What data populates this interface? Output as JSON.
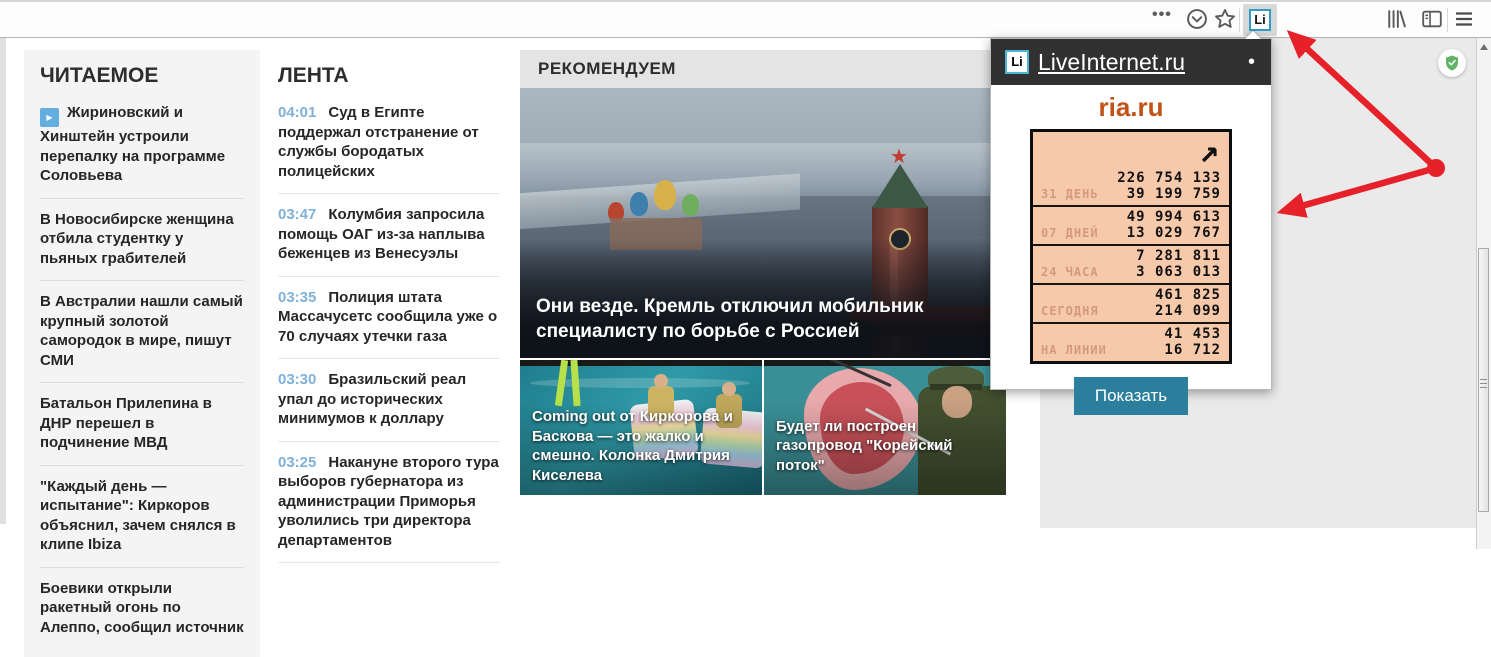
{
  "browser": {
    "li_badge": "Li"
  },
  "readable": {
    "title": "ЧИТАЕМОЕ",
    "items": [
      {
        "text": "Жириновский и Хинштейн устроили перепалку на программе Соловьева",
        "video": true
      },
      {
        "text": "В Новосибирске женщина отбила студентку у пьяных грабителей"
      },
      {
        "text": "В Австралии нашли самый крупный золотой самородок в мире, пишут СМИ"
      },
      {
        "text": "Батальон Прилепина в ДНР перешел в подчинение МВД"
      },
      {
        "text": "\"Каждый день — испытание\": Киркоров объяснил, зачем снялся в клипе Ibiza"
      },
      {
        "text": "Боевики открыли ракетный огонь по Алеппо, сообщил источник"
      }
    ]
  },
  "feed": {
    "title": "ЛЕНТА",
    "items": [
      {
        "time": "04:01",
        "text": "Суд в Египте поддержал отстранение от службы бородатых полицейских"
      },
      {
        "time": "03:47",
        "text": "Колумбия запросила помощь ОАГ из-за наплыва беженцев из Венесуэлы"
      },
      {
        "time": "03:35",
        "text": "Полиция штата Массачусетс сообщила уже о 70 случаях утечки газа"
      },
      {
        "time": "03:30",
        "text": "Бразильский реал упал до исторических минимумов к доллару"
      },
      {
        "time": "03:25",
        "text": "Накануне второго тура выборов губернатора из администрации Приморья уволились три директора департаментов"
      }
    ]
  },
  "recommend": {
    "title": "РЕКОМЕНДУЕМ",
    "main_story": "Они везде. Кремль отключил мобильник специалисту по борьбе с Россией",
    "cards": [
      {
        "text": "Coming out от Киркорова и Баскова — это жалко и смешно. Колонка Дмитрия Киселева"
      },
      {
        "text": "Будет ли построен газопровод \"Корейский поток\""
      }
    ]
  },
  "popup": {
    "badge": "Li",
    "brand": "LiveInternet.ru",
    "menu_dot": "•",
    "site": "ria.ru",
    "arrow": "↗",
    "counter": {
      "rows": [
        {
          "label": "31 ДЕНЬ",
          "hits": "226 754 133",
          "visitors": "39 199 759"
        },
        {
          "label": "07 ДНЕЙ",
          "hits": "49 994 613",
          "visitors": "13 029 767"
        },
        {
          "label": "24 ЧАСА",
          "hits": "7 281 811",
          "visitors": "3 063 013"
        },
        {
          "label": "СЕГОДНЯ",
          "hits": "461 825",
          "visitors": "214 099"
        },
        {
          "label": "НА ЛИНИИ",
          "hits": "41 453",
          "visitors": "16 712"
        }
      ]
    },
    "button": "Показать"
  },
  "colors": {
    "annotation_red": "#e62129",
    "counter_bg": "#f7c9ab",
    "button_teal": "#2b7e9c",
    "site_orange": "#c25317",
    "time_blue": "#7fb1d9",
    "shield_green": "#61b365"
  }
}
